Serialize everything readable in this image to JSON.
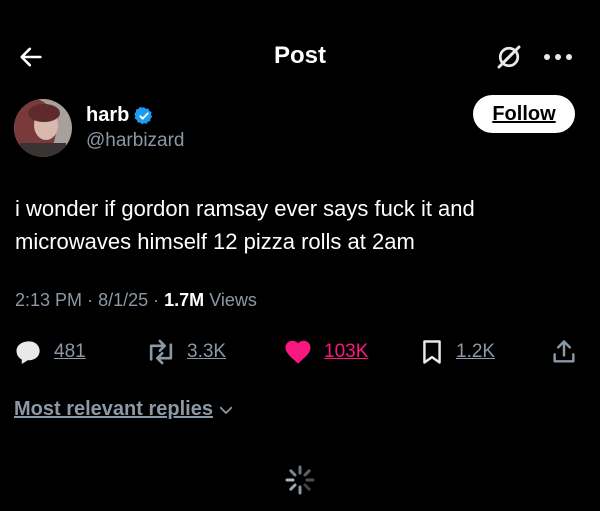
{
  "header": {
    "title": "Post",
    "back_icon": "arrow-left-icon",
    "grok_icon": "grok-icon",
    "more_icon": "more-dots-icon"
  },
  "author": {
    "name": "harb",
    "handle": "@harbizard",
    "verified": true,
    "avatar_icon": "profile-avatar",
    "follow_label": "Follow"
  },
  "tweet": {
    "text_line1": "i wonder if gordon ramsay ever says fuck it and",
    "text_line2": "microwaves himself 12 pizza rolls at 2am"
  },
  "meta": {
    "time": "2:13 PM",
    "date": "8/1/25",
    "views_count": "1.7M",
    "views_label": "Views",
    "separator": "·"
  },
  "actions": {
    "replies": "481",
    "reposts": "3.3K",
    "likes": "103K",
    "bookmarks": "1.2K"
  },
  "replies_sort": {
    "label": "Most relevant replies"
  },
  "colors": {
    "background": "#000000",
    "text_primary": "#ffffff",
    "text_secondary": "#8b98a5",
    "like_pink": "#f91880",
    "verified_blue": "#1d9bf0"
  }
}
